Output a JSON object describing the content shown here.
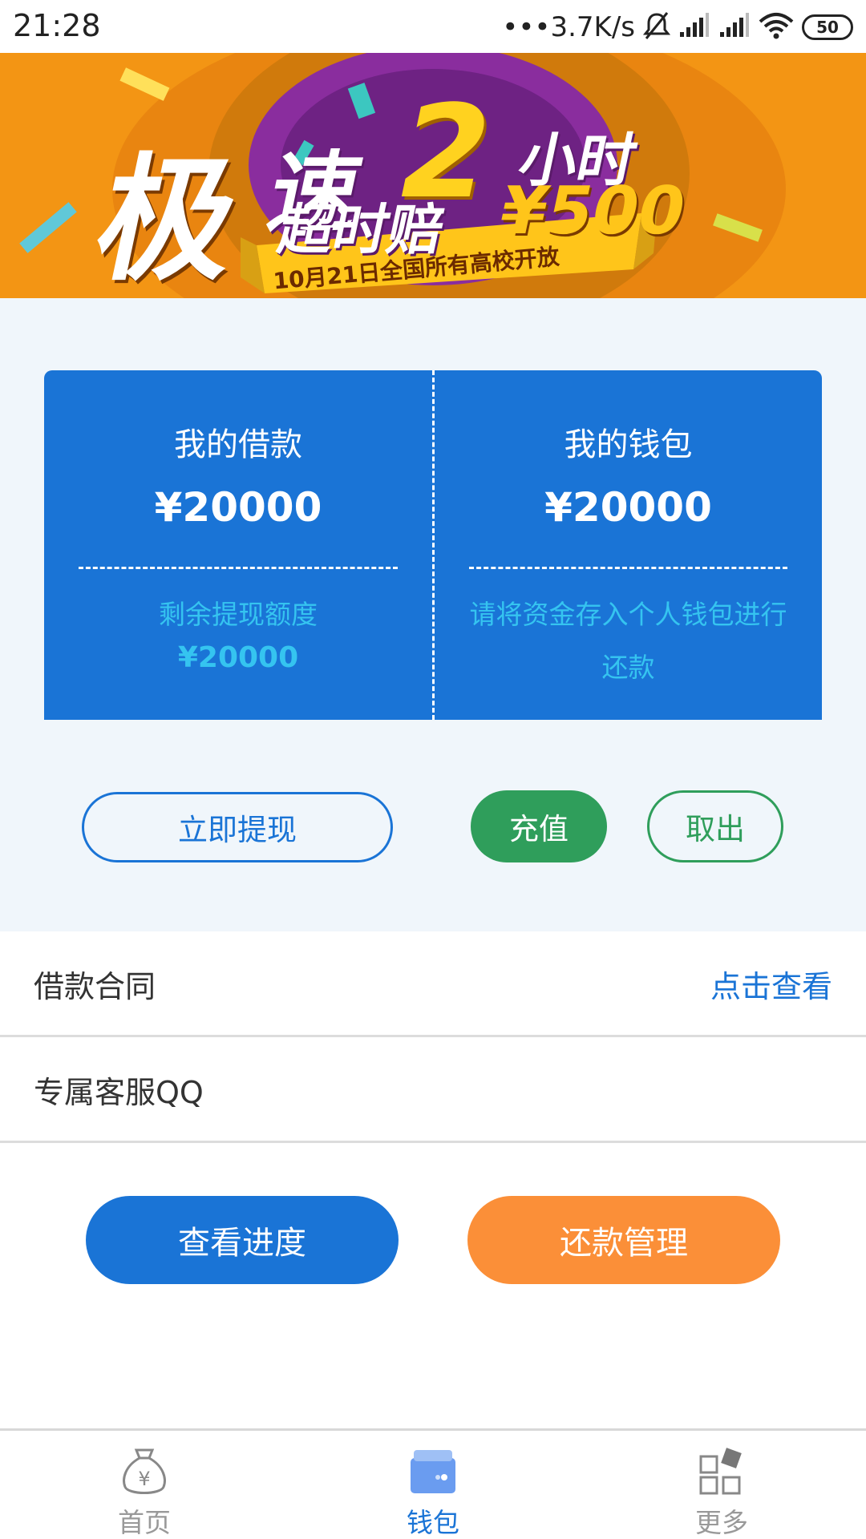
{
  "status_bar": {
    "time": "21:28",
    "net_speed": "•••3.7K/s",
    "battery": "50",
    "icons": [
      "mute-bell-icon",
      "signal-icon",
      "signal-icon",
      "wifi-icon",
      "battery-icon"
    ]
  },
  "banner": {
    "big_char_1": "极",
    "big_char_2": "速",
    "number": "2",
    "hours": "小时",
    "overtime": "超时赔",
    "amount": "¥500",
    "ribbon": "10月21日全国所有高校开放",
    "colors": {
      "background": "#f28f12",
      "circle": "#8a2d9e",
      "yellow": "#ffc51a"
    }
  },
  "loan_card": {
    "title": "我的借款",
    "amount": "¥20000",
    "sub_label": "剩余提现额度",
    "sub_amount": "¥20000"
  },
  "wallet_card": {
    "title": "我的钱包",
    "amount": "¥20000",
    "note": "请将资金存入个人钱包进行还款"
  },
  "actions": {
    "withdraw": "立即提现",
    "recharge": "充值",
    "take_out": "取出"
  },
  "list": {
    "contract_label": "借款合同",
    "contract_link": "点击查看",
    "qq_label": "专属客服QQ"
  },
  "bottom_buttons": {
    "progress": "查看进度",
    "repay": "还款管理"
  },
  "nav": {
    "items": [
      {
        "label": "首页",
        "icon": "money-bag-icon",
        "active": false
      },
      {
        "label": "钱包",
        "icon": "wallet-icon",
        "active": true
      },
      {
        "label": "更多",
        "icon": "grid-icon",
        "active": false
      }
    ]
  },
  "colors": {
    "primary_blue": "#1a74d6",
    "green": "#2f9e5b",
    "orange": "#fb8f38",
    "light_bg": "#f0f6fb",
    "accent_cyan": "#35c4f0"
  }
}
